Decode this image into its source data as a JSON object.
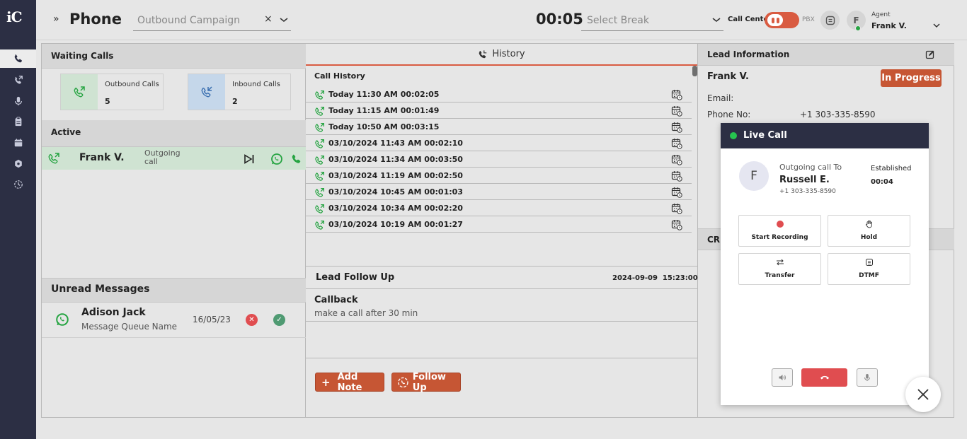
{
  "app": {
    "logo": "iC",
    "title": "Phone"
  },
  "header": {
    "campaign_placeholder": "Outbound Campaign",
    "clear_symbol": "×",
    "timer": "00:05",
    "break_placeholder": "Select Break",
    "call_center_label": "Call Center",
    "pbx_label": "PBX",
    "agent": {
      "initial": "F",
      "role": "Agent",
      "name": "Frank V.",
      "status_color": "#26a442"
    }
  },
  "sidebar": {
    "items": [
      {
        "icon": "phone-icon",
        "active": true
      },
      {
        "icon": "call-forward-icon",
        "active": false
      },
      {
        "icon": "microphone-icon",
        "active": false
      },
      {
        "icon": "clipboard-icon",
        "active": false
      },
      {
        "icon": "calendar-icon",
        "active": false
      },
      {
        "icon": "settings-icon",
        "active": false
      },
      {
        "icon": "history-clock-icon",
        "active": false
      }
    ]
  },
  "waiting_calls": {
    "title": "Waiting Calls",
    "outbound": {
      "label": "Outbound Calls",
      "count": "5",
      "color": "#cfe3d2"
    },
    "inbound": {
      "label": "Inbound Calls",
      "count": "2",
      "color": "#c5d7ea"
    }
  },
  "active": {
    "title": "Active",
    "call": {
      "name": "Frank V.",
      "status": "Outgoing call"
    }
  },
  "unread_messages": {
    "title": "Unread Messages",
    "items": [
      {
        "sender": "Adison Jack",
        "queue": "Message Queue Name",
        "date": "16/05/23"
      }
    ]
  },
  "history": {
    "tab_label": "History",
    "title": "Call History",
    "rows": [
      "Today 11:30 AM 00:02:05",
      "Today 11:15 AM 00:01:49",
      "Today 10:50 AM 00:03:15",
      "03/10/2024 11:43 AM 00:02:10",
      "03/10/2024 11:34 AM 00:03:50",
      "03/10/2024 11:19 AM 00:02:50",
      "03/10/2024 10:45 AM 00:01:03",
      "03/10/2024 10:34 AM 00:02:20",
      "03/10/2024 10:19 AM 00:01:27"
    ]
  },
  "follow_up": {
    "title": "Lead Follow Up",
    "datetime": "2024-09-09  15:23:00",
    "item_title": "Callback",
    "item_note": "make a call after 30 min",
    "add_note_label": "Add Note",
    "follow_up_label": "Follow Up"
  },
  "lead": {
    "title": "Lead Information",
    "name": "Frank V.",
    "status": "In Progress",
    "email_label": "Email:",
    "phone_label": "Phone No:",
    "phone": "+1 303-335-8590",
    "crm_label": "CRM"
  },
  "live_call": {
    "title": "Live Call",
    "initial": "F",
    "direction": "Outgoing call To",
    "name": "Russell E.",
    "number": "+1 303-335-8590",
    "state": "Established",
    "duration": "00:04",
    "controls": {
      "record": "Start Recording",
      "hold": "Hold",
      "transfer": "Transfer",
      "dtmf": "DTMF"
    }
  },
  "colors": {
    "accent": "#c65634",
    "sidebar": "#2c2f44",
    "whatsapp": "#26a442",
    "hangup": "#e04d50"
  }
}
